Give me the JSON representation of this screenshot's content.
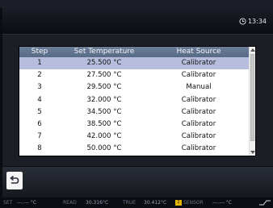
{
  "header": {
    "time": "13:34"
  },
  "table": {
    "columns": [
      "Step",
      "Set Temperature",
      "Heat Source"
    ],
    "rows": [
      {
        "step": "1",
        "temperature": "25.500 °C",
        "source": "Calibrator",
        "selected": true
      },
      {
        "step": "2",
        "temperature": "27.500 °C",
        "source": "Calibrator"
      },
      {
        "step": "3",
        "temperature": "29.500 °C",
        "source": "Manual"
      },
      {
        "step": "4",
        "temperature": "32.000 °C",
        "source": "Calibrator"
      },
      {
        "step": "5",
        "temperature": "34.500 °C",
        "source": "Calibrator"
      },
      {
        "step": "6",
        "temperature": "38.500 °C",
        "source": "Calibrator"
      },
      {
        "step": "7",
        "temperature": "42.000 °C",
        "source": "Calibrator"
      },
      {
        "step": "8",
        "temperature": "50.000 °C",
        "source": "Calibrator"
      }
    ]
  },
  "status_bar": {
    "set_label": "SET",
    "set_value": "---.--- °C",
    "read_label": "READ",
    "read_value": "30.316°C",
    "true_label": "TRUE",
    "true_value": "30.412°C",
    "badge": "2",
    "sensor_label": "SENSOR",
    "sensor_value": "---.--- °C"
  },
  "icons": {
    "clock": "clock-icon",
    "back": "back-arrow-icon",
    "scroll_up": "scroll-up-icon",
    "scroll_down": "scroll-down-icon",
    "connection": "connection-icon"
  },
  "colors": {
    "header_row": "#5f7290",
    "selected_row": "#b7bedd",
    "badge": "#e6b400"
  }
}
